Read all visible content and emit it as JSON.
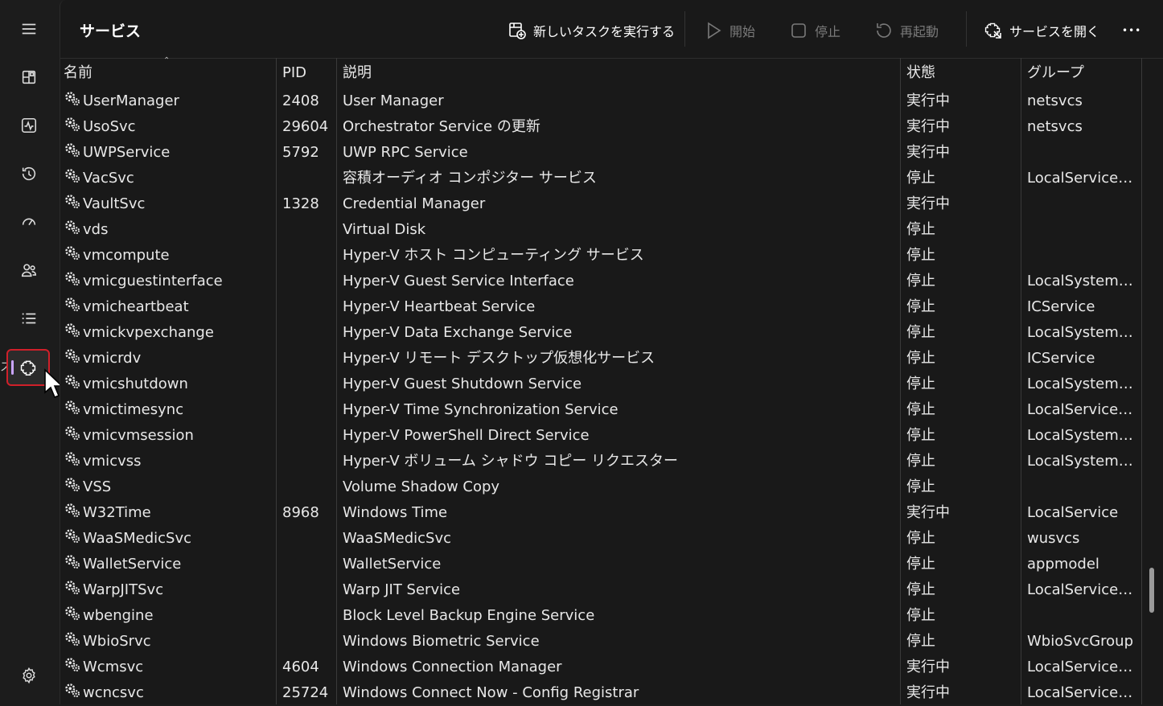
{
  "page": {
    "title": "サービス"
  },
  "toolbar": {
    "new_task": "新しいタスクを実行する",
    "start": "開始",
    "stop": "停止",
    "restart": "再起動",
    "open_services": "サービスを開く",
    "more": "•••"
  },
  "nav": {
    "clipped_label": "ス"
  },
  "columns": {
    "name": "名前",
    "pid": "PID",
    "desc": "説明",
    "state": "状態",
    "group": "グループ"
  },
  "services": [
    {
      "name": "UserManager",
      "pid": "2408",
      "desc": "User Manager",
      "state": "実行中",
      "group": "netsvcs"
    },
    {
      "name": "UsoSvc",
      "pid": "29604",
      "desc": "Orchestrator Service の更新",
      "state": "実行中",
      "group": "netsvcs"
    },
    {
      "name": "UWPService",
      "pid": "5792",
      "desc": "UWP RPC Service",
      "state": "実行中",
      "group": ""
    },
    {
      "name": "VacSvc",
      "pid": "",
      "desc": "容積オーディオ コンポジター サービス",
      "state": "停止",
      "group": "LocalServiceN..."
    },
    {
      "name": "VaultSvc",
      "pid": "1328",
      "desc": "Credential Manager",
      "state": "実行中",
      "group": ""
    },
    {
      "name": "vds",
      "pid": "",
      "desc": "Virtual Disk",
      "state": "停止",
      "group": ""
    },
    {
      "name": "vmcompute",
      "pid": "",
      "desc": "Hyper-V ホスト コンピューティング サービス",
      "state": "停止",
      "group": ""
    },
    {
      "name": "vmicguestinterface",
      "pid": "",
      "desc": "Hyper-V Guest Service Interface",
      "state": "停止",
      "group": "LocalSystemN..."
    },
    {
      "name": "vmicheartbeat",
      "pid": "",
      "desc": "Hyper-V Heartbeat Service",
      "state": "停止",
      "group": "ICService"
    },
    {
      "name": "vmickvpexchange",
      "pid": "",
      "desc": "Hyper-V Data Exchange Service",
      "state": "停止",
      "group": "LocalSystemN..."
    },
    {
      "name": "vmicrdv",
      "pid": "",
      "desc": "Hyper-V リモート デスクトップ仮想化サービス",
      "state": "停止",
      "group": "ICService"
    },
    {
      "name": "vmicshutdown",
      "pid": "",
      "desc": "Hyper-V Guest Shutdown Service",
      "state": "停止",
      "group": "LocalSystemN..."
    },
    {
      "name": "vmictimesync",
      "pid": "",
      "desc": "Hyper-V Time Synchronization Service",
      "state": "停止",
      "group": "LocalServiceN..."
    },
    {
      "name": "vmicvmsession",
      "pid": "",
      "desc": "Hyper-V PowerShell Direct Service",
      "state": "停止",
      "group": "LocalSystemN..."
    },
    {
      "name": "vmicvss",
      "pid": "",
      "desc": "Hyper-V ボリューム シャドウ コピー リクエスター",
      "state": "停止",
      "group": "LocalSystemN..."
    },
    {
      "name": "VSS",
      "pid": "",
      "desc": "Volume Shadow Copy",
      "state": "停止",
      "group": ""
    },
    {
      "name": "W32Time",
      "pid": "8968",
      "desc": "Windows Time",
      "state": "実行中",
      "group": "LocalService"
    },
    {
      "name": "WaaSMedicSvc",
      "pid": "",
      "desc": "WaaSMedicSvc",
      "state": "停止",
      "group": "wusvcs"
    },
    {
      "name": "WalletService",
      "pid": "",
      "desc": "WalletService",
      "state": "停止",
      "group": "appmodel"
    },
    {
      "name": "WarpJITSvc",
      "pid": "",
      "desc": "Warp JIT Service",
      "state": "停止",
      "group": "LocalServiceN..."
    },
    {
      "name": "wbengine",
      "pid": "",
      "desc": "Block Level Backup Engine Service",
      "state": "停止",
      "group": ""
    },
    {
      "name": "WbioSrvc",
      "pid": "",
      "desc": "Windows Biometric Service",
      "state": "停止",
      "group": "WbioSvcGroup"
    },
    {
      "name": "Wcmsvc",
      "pid": "4604",
      "desc": "Windows Connection Manager",
      "state": "実行中",
      "group": "LocalServiceN..."
    },
    {
      "name": "wcncsvc",
      "pid": "25724",
      "desc": "Windows Connect Now - Config Registrar",
      "state": "実行中",
      "group": "LocalServiceA..."
    }
  ]
}
